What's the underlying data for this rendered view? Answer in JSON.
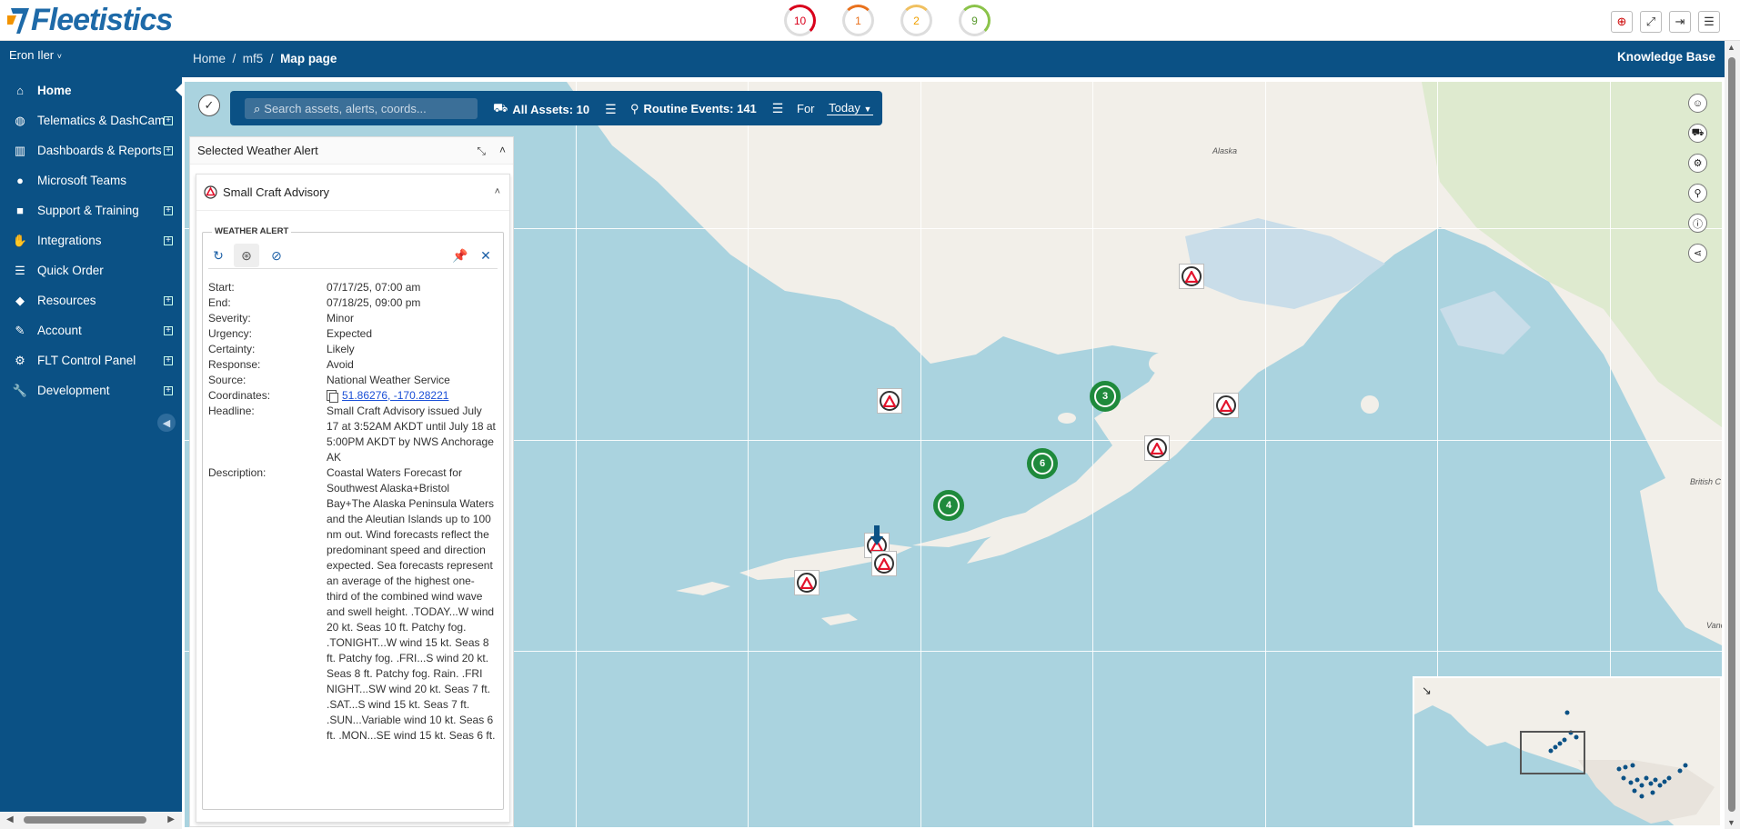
{
  "app": {
    "logo": "Fleetistics"
  },
  "counters": [
    {
      "value": "10"
    },
    {
      "value": "1"
    },
    {
      "value": "2"
    },
    {
      "value": "9"
    }
  ],
  "top_icons": [
    "plus-circle-icon",
    "fullscreen-icon",
    "logout-icon",
    "menu-icon"
  ],
  "sidebar": {
    "user": "Eron Iler",
    "items": [
      {
        "label": "Home",
        "icon": "home-icon",
        "expandable": false,
        "active": true
      },
      {
        "label": "Telematics & DashCam",
        "icon": "globe-icon",
        "expandable": true
      },
      {
        "label": "Dashboards & Reports",
        "icon": "bar-chart-icon",
        "expandable": true
      },
      {
        "label": "Microsoft Teams",
        "icon": "chat-icon",
        "expandable": false
      },
      {
        "label": "Support & Training",
        "icon": "briefcase-icon",
        "expandable": true
      },
      {
        "label": "Integrations",
        "icon": "handshake-icon",
        "expandable": true
      },
      {
        "label": "Quick Order",
        "icon": "list-icon",
        "expandable": false
      },
      {
        "label": "Resources",
        "icon": "box-icon",
        "expandable": true
      },
      {
        "label": "Account",
        "icon": "edit-icon",
        "expandable": true
      },
      {
        "label": "FLT Control Panel",
        "icon": "gears-icon",
        "expandable": true
      },
      {
        "label": "Development",
        "icon": "wrench-icon",
        "expandable": true
      }
    ]
  },
  "breadcrumb": {
    "home": "Home",
    "mid": "mf5",
    "current": "Map page"
  },
  "header": {
    "knowledge_base": "Knowledge Base"
  },
  "toolbar": {
    "search_placeholder": "Search assets, alerts, coords...",
    "assets": "All Assets: 10",
    "events": "Routine Events: 141",
    "for_label": "For",
    "for_value": "Today"
  },
  "panel": {
    "title": "Selected Weather Alert",
    "alert_title": "Small Craft Advisory",
    "box_legend": "WEATHER ALERT",
    "fields": [
      {
        "k": "Start:",
        "v": "07/17/25, 07:00 am"
      },
      {
        "k": "End:",
        "v": "07/18/25, 09:00 pm"
      },
      {
        "k": "Severity:",
        "v": "Minor"
      },
      {
        "k": "Urgency:",
        "v": "Expected"
      },
      {
        "k": "Certainty:",
        "v": "Likely"
      },
      {
        "k": "Response:",
        "v": "Avoid"
      },
      {
        "k": "Source:",
        "v": "National Weather Service"
      }
    ],
    "coordinates_label": "Coordinates:",
    "coordinates_value": "51.86276, -170.28221",
    "headline_label": "Headline:",
    "headline_value": "Small Craft Advisory issued July 17 at 3:52AM AKDT until July 18 at 5:00PM AKDT by NWS Anchorage AK",
    "description_label": "Description:",
    "description_value": "Coastal Waters Forecast for Southwest Alaska+Bristol Bay+The Alaska Peninsula Waters and the Aleutian Islands up to 100 nm out. Wind forecasts reflect the predominant speed and direction expected. Sea forecasts represent an average of the highest one-third of the combined wind wave and swell height. .TODAY...W wind 20 kt. Seas 10 ft. Patchy fog. .TONIGHT...W wind 15 kt. Seas 8 ft. Patchy fog. .FRI...S wind 20 kt. Seas 8 ft. Patchy fog. Rain. .FRI NIGHT...SW wind 20 kt. Seas 7 ft. .SAT...S wind 15 kt. Seas 7 ft. .SUN...Variable wind 10 kt. Seas 6 ft. .MON...SE wind 15 kt. Seas 6 ft."
  },
  "map": {
    "labels": {
      "alaska": "Alaska",
      "bc": "British C",
      "vanc": "Vanc"
    },
    "clusters": [
      {
        "count": "3"
      },
      {
        "count": "6"
      },
      {
        "count": "4"
      }
    ],
    "tools": [
      "smile-icon",
      "car-icon",
      "gear-icon",
      "location-pin-icon",
      "info-icon",
      "share-icon"
    ]
  }
}
